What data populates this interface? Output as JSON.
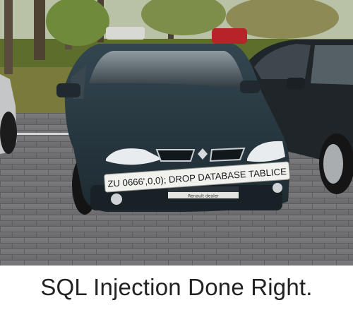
{
  "photo": {
    "license_plate_text": "ZU 0666',0,0); DROP DATABASE TABLICE",
    "plate_strip_text": "Renault dealer"
  },
  "caption": "SQL Injection Done Right."
}
